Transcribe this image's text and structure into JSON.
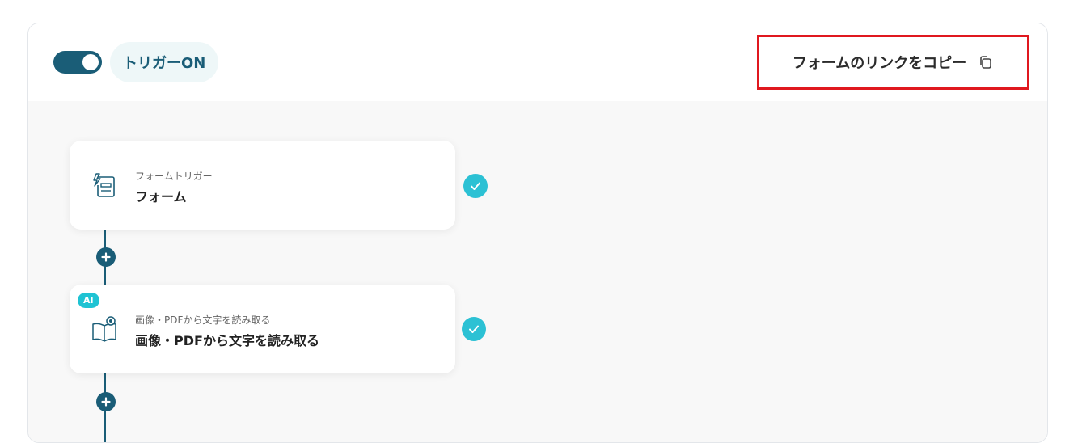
{
  "header": {
    "trigger_label": "トリガーON",
    "trigger_on": true,
    "copy_link_label": "フォームのリンクをコピー",
    "copy_icon": "copy-icon"
  },
  "flow": {
    "steps": [
      {
        "sub": "フォームトリガー",
        "title": "フォーム",
        "icon": "form-trigger-icon",
        "status": "complete"
      },
      {
        "badge": "AI",
        "sub": "画像・PDFから文字を読み取る",
        "title": "画像・PDFから文字を読み取る",
        "icon": "ocr-book-icon",
        "status": "complete"
      }
    ],
    "add_step_icon": "plus-icon",
    "check_icon": "check-icon"
  },
  "colors": {
    "primary": "#1a5d77",
    "accent": "#2cc1d4",
    "highlight_border": "#e0181f"
  }
}
